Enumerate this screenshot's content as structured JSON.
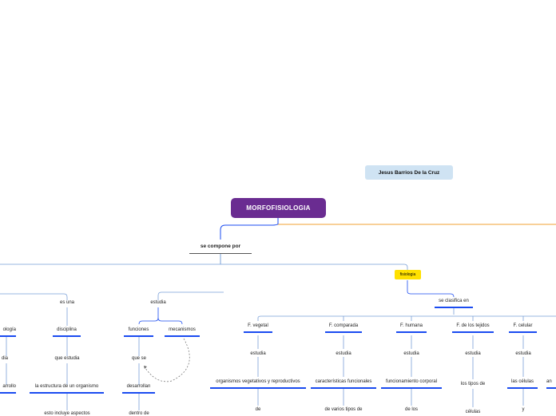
{
  "author": "Jesus Barrios De la Cruz",
  "root": "MORFOFISIOLOGIA",
  "compone": "se compone por",
  "fisiologia": "fisiologia",
  "clasifica": "se clasifica en",
  "left_branch": {
    "es_una": "es una",
    "disciplina": "disciplina",
    "que_estudia": "que estudia",
    "estructura": "la estructura de un organismo",
    "esto_incluye": "esto incluye aspectos",
    "ologia": "ología",
    "dia": "dia",
    "arrollo": "arrollo"
  },
  "mid_branch": {
    "estudia": "estudia",
    "funciones": "funciones",
    "mecanismos": "mecanismos",
    "que_se": "que se",
    "desarrollan": "desarrollan",
    "dentro_de": "dentro de"
  },
  "types": [
    {
      "name": "F. vegetal",
      "verb": "estudia",
      "object": "organismos vegetativos y reproductivos",
      "next": "de"
    },
    {
      "name": "F. comparada",
      "verb": "estudia",
      "object": "características funcionales",
      "next": "de varios tipos de"
    },
    {
      "name": "F. humana",
      "verb": "estudia",
      "object": "funcionamiento corporal",
      "next": "de los"
    },
    {
      "name": "F. de los tejidos",
      "verb": "estudia",
      "object": "los tipos de",
      "next": "células"
    },
    {
      "name": "F. celular",
      "verb": "estudia",
      "object": "las células",
      "next": "y"
    }
  ],
  "edge_partial": "an",
  "colors": {
    "root": "#6a2c91",
    "author": "#cfe3f3",
    "fisio": "#ffe000",
    "underline": "#1a4bf0",
    "line": "#7aa0d8",
    "orange": "#f0a030"
  }
}
